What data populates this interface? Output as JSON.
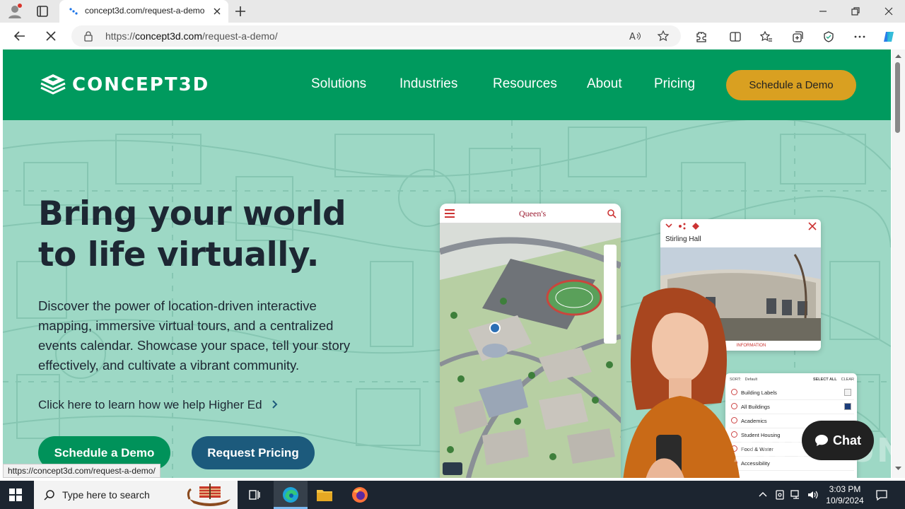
{
  "browser": {
    "tab_title": "concept3d.com/request-a-demo",
    "url_domain": "concept3d.com",
    "url_prefix": "https://",
    "url_path": "/request-a-demo/",
    "status_url": "https://concept3d.com/request-a-demo/"
  },
  "site": {
    "logo_text": "CONCEPT3D",
    "nav": [
      "Solutions",
      "Industries",
      "Resources",
      "About",
      "Pricing"
    ],
    "header_cta": "Schedule a Demo",
    "brand_color": "#009a5e",
    "accent_color": "#d9a021"
  },
  "hero": {
    "title_line1": "Bring your world",
    "title_line2": "to life virtually.",
    "subtitle": "Discover the power of location-driven interactive mapping, immersive virtual tours, and a centralized events calendar. Showcase your space, tell your story effectively, and cultivate a vibrant community.",
    "higher_ed_link": "Click here to learn how we help Higher Ed",
    "primary_cta": "Schedule a Demo",
    "secondary_cta": "Request Pricing"
  },
  "mockup": {
    "phone_brand": "Queen's",
    "photo_card_title": "Stirling Hall",
    "photo_card_footer": "INFORMATION",
    "list_header_sort": "SORT:",
    "list_header_default": "Default",
    "list_header_select": "SELECT ALL",
    "list_header_clear": "CLEAR",
    "list_items": [
      "Building Labels",
      "All Buildings",
      "Academics",
      "Student Housing",
      "Food & Water",
      "Accessibility"
    ]
  },
  "chat": {
    "label": "Chat"
  },
  "watermark": "ANY.RUN",
  "taskbar": {
    "search_placeholder": "Type here to search",
    "time": "3:03 PM",
    "date": "10/9/2024"
  }
}
